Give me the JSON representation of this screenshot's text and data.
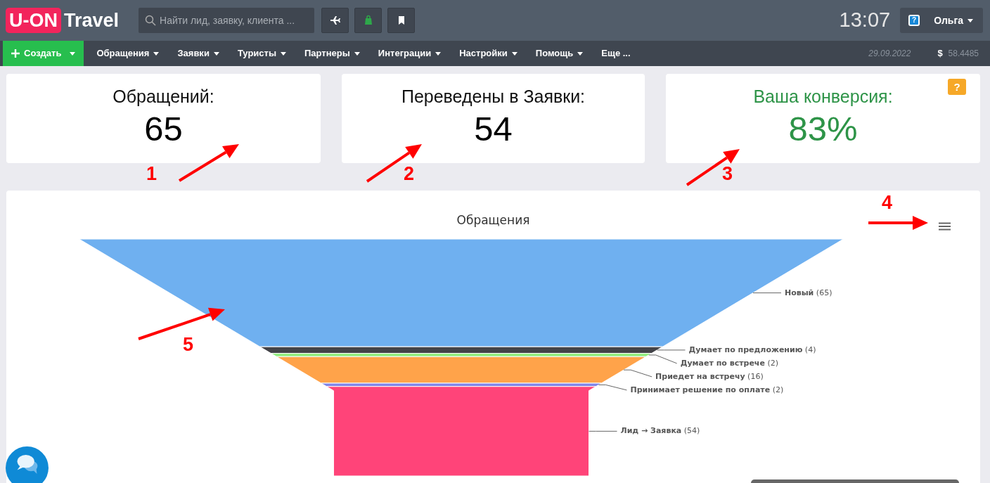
{
  "header": {
    "logo": {
      "part_1": "U-ON",
      "part_2": "Travel"
    },
    "search": {
      "placeholder": "Найти лид, заявку, клиента ..."
    },
    "clock": "13:07",
    "user": {
      "help": "?",
      "name": "Ольга"
    }
  },
  "nav": {
    "create": "Создать",
    "items": [
      {
        "label": "Обращения",
        "dropdown": true
      },
      {
        "label": "Заявки",
        "dropdown": true
      },
      {
        "label": "Туристы",
        "dropdown": true
      },
      {
        "label": "Партнеры",
        "dropdown": true
      },
      {
        "label": "Интеграции",
        "dropdown": true
      },
      {
        "label": "Настройки",
        "dropdown": true
      },
      {
        "label": "Помощь",
        "dropdown": true
      },
      {
        "label": "Еще ...",
        "dropdown": false
      }
    ],
    "date": "29.09.2022",
    "currency": {
      "symbol": "$",
      "rate": "58.4485"
    }
  },
  "stats": [
    {
      "label": "Обращений:",
      "value": "65",
      "highlight": false
    },
    {
      "label": "Переведены в Заявки:",
      "value": "54",
      "highlight": false
    },
    {
      "label": "Ваша конверсия:",
      "value": "83%",
      "highlight": true,
      "help": "?"
    }
  ],
  "chart": {
    "title": "Обращения",
    "stages": [
      {
        "name": "Новый",
        "count": "(65)",
        "color": "#6fb0f0"
      },
      {
        "name": "Думает по предложению",
        "count": "(4)",
        "color": "#434348"
      },
      {
        "name": "Думает по встрече",
        "count": "(2)",
        "color": "#90ed7d"
      },
      {
        "name": "Приедет на встречу",
        "count": "(16)",
        "color": "#ffa34a"
      },
      {
        "name": "Принимает решение по оплате",
        "count": "(2)",
        "color": "#8085e9"
      },
      {
        "name": "Лид → Заявка",
        "count": "(54)",
        "color": "#ff4479"
      }
    ]
  },
  "annotations": [
    {
      "label": "1"
    },
    {
      "label": "2"
    },
    {
      "label": "3"
    },
    {
      "label": "4"
    },
    {
      "label": "5"
    }
  ]
}
